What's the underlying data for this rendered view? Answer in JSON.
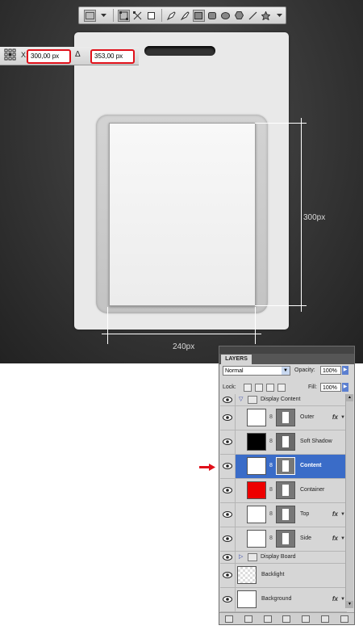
{
  "options_bar": {
    "x_label": "X:",
    "x_value": "300,00 px",
    "delta_glyph": "Δ",
    "y_label": "Y:",
    "y_value": "353,00 px"
  },
  "dimensions": {
    "height_label": "300px",
    "width_label": "240px"
  },
  "toolbar": {
    "icons": [
      "rectangle-shape-icon",
      "path-mode-icon",
      "fill-pixels-icon",
      "pen-icon",
      "freeform-pen-icon",
      "rectangle-tool-icon",
      "rounded-rect-tool-icon",
      "ellipse-tool-icon",
      "polygon-tool-icon",
      "line-tool-icon",
      "custom-shape-tool-icon"
    ]
  },
  "layers_panel": {
    "tab": "LAYERS",
    "blend_mode": "Normal",
    "opacity_label": "Opacity:",
    "opacity_value": "100%",
    "lock_label": "Lock:",
    "fill_label": "Fill:",
    "fill_value": "100%",
    "layers": [
      {
        "name": "Display Content",
        "kind": "group",
        "expanded": true
      },
      {
        "name": "Outer",
        "kind": "layer",
        "thumb": "#ffffff",
        "fx": true
      },
      {
        "name": "Soft Shadow",
        "kind": "layer",
        "thumb": "#000000",
        "fx": false
      },
      {
        "name": "Content",
        "kind": "layer",
        "thumb": "#ffffff",
        "fx": false,
        "selected": true
      },
      {
        "name": "Container",
        "kind": "layer",
        "thumb": "#ee0000",
        "fx": false
      },
      {
        "name": "Top",
        "kind": "layer",
        "thumb": "#ffffff",
        "fx": true
      },
      {
        "name": "Side",
        "kind": "layer",
        "thumb": "#ffffff",
        "fx": true
      },
      {
        "name": "Display Board",
        "kind": "group",
        "expanded": false
      },
      {
        "name": "Backlight",
        "kind": "plain"
      },
      {
        "name": "Background",
        "kind": "plain",
        "fx": true
      }
    ],
    "fx_symbol": "fx"
  },
  "colors": {
    "selection": "#3a6cc8",
    "highlight_red": "#e0101a"
  }
}
